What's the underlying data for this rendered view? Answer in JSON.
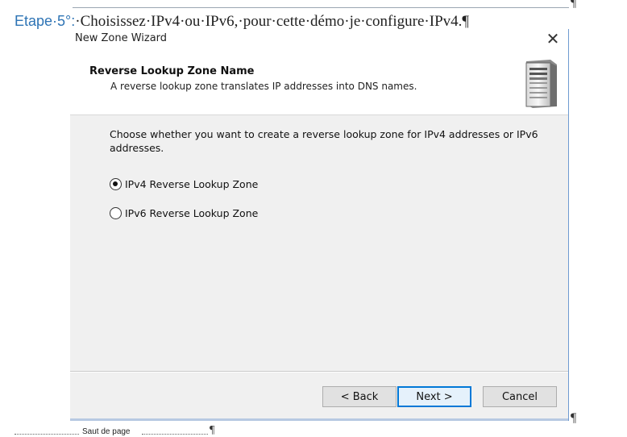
{
  "document": {
    "heading_step": "Etape·5°:",
    "heading_body": "·Choisissez·IPv4·ou·IPv6,·pour·cette·démo·je·configure·IPv4.¶",
    "pilcrow": "¶",
    "page_break_label": "Saut de page",
    "page_break_pilcrow": "¶"
  },
  "dialog": {
    "title": "New Zone Wizard",
    "close_glyph": "✕",
    "header": {
      "title": "Reverse Lookup Zone Name",
      "subtitle": "A reverse lookup zone translates IP addresses into DNS names.",
      "icon": "server-icon"
    },
    "instruction": "Choose whether you want to create a reverse lookup zone for IPv4 addresses or IPv6 addresses.",
    "options": [
      {
        "label": "IPv4 Reverse Lookup Zone",
        "checked": true
      },
      {
        "label": "IPv6 Reverse Lookup Zone",
        "checked": false
      }
    ],
    "buttons": {
      "back": "< Back",
      "next": "Next >",
      "cancel": "Cancel"
    }
  },
  "colors": {
    "accent": "#0078d7",
    "heading_blue": "#2e74b5",
    "dialog_bg": "#f0f0f0"
  }
}
